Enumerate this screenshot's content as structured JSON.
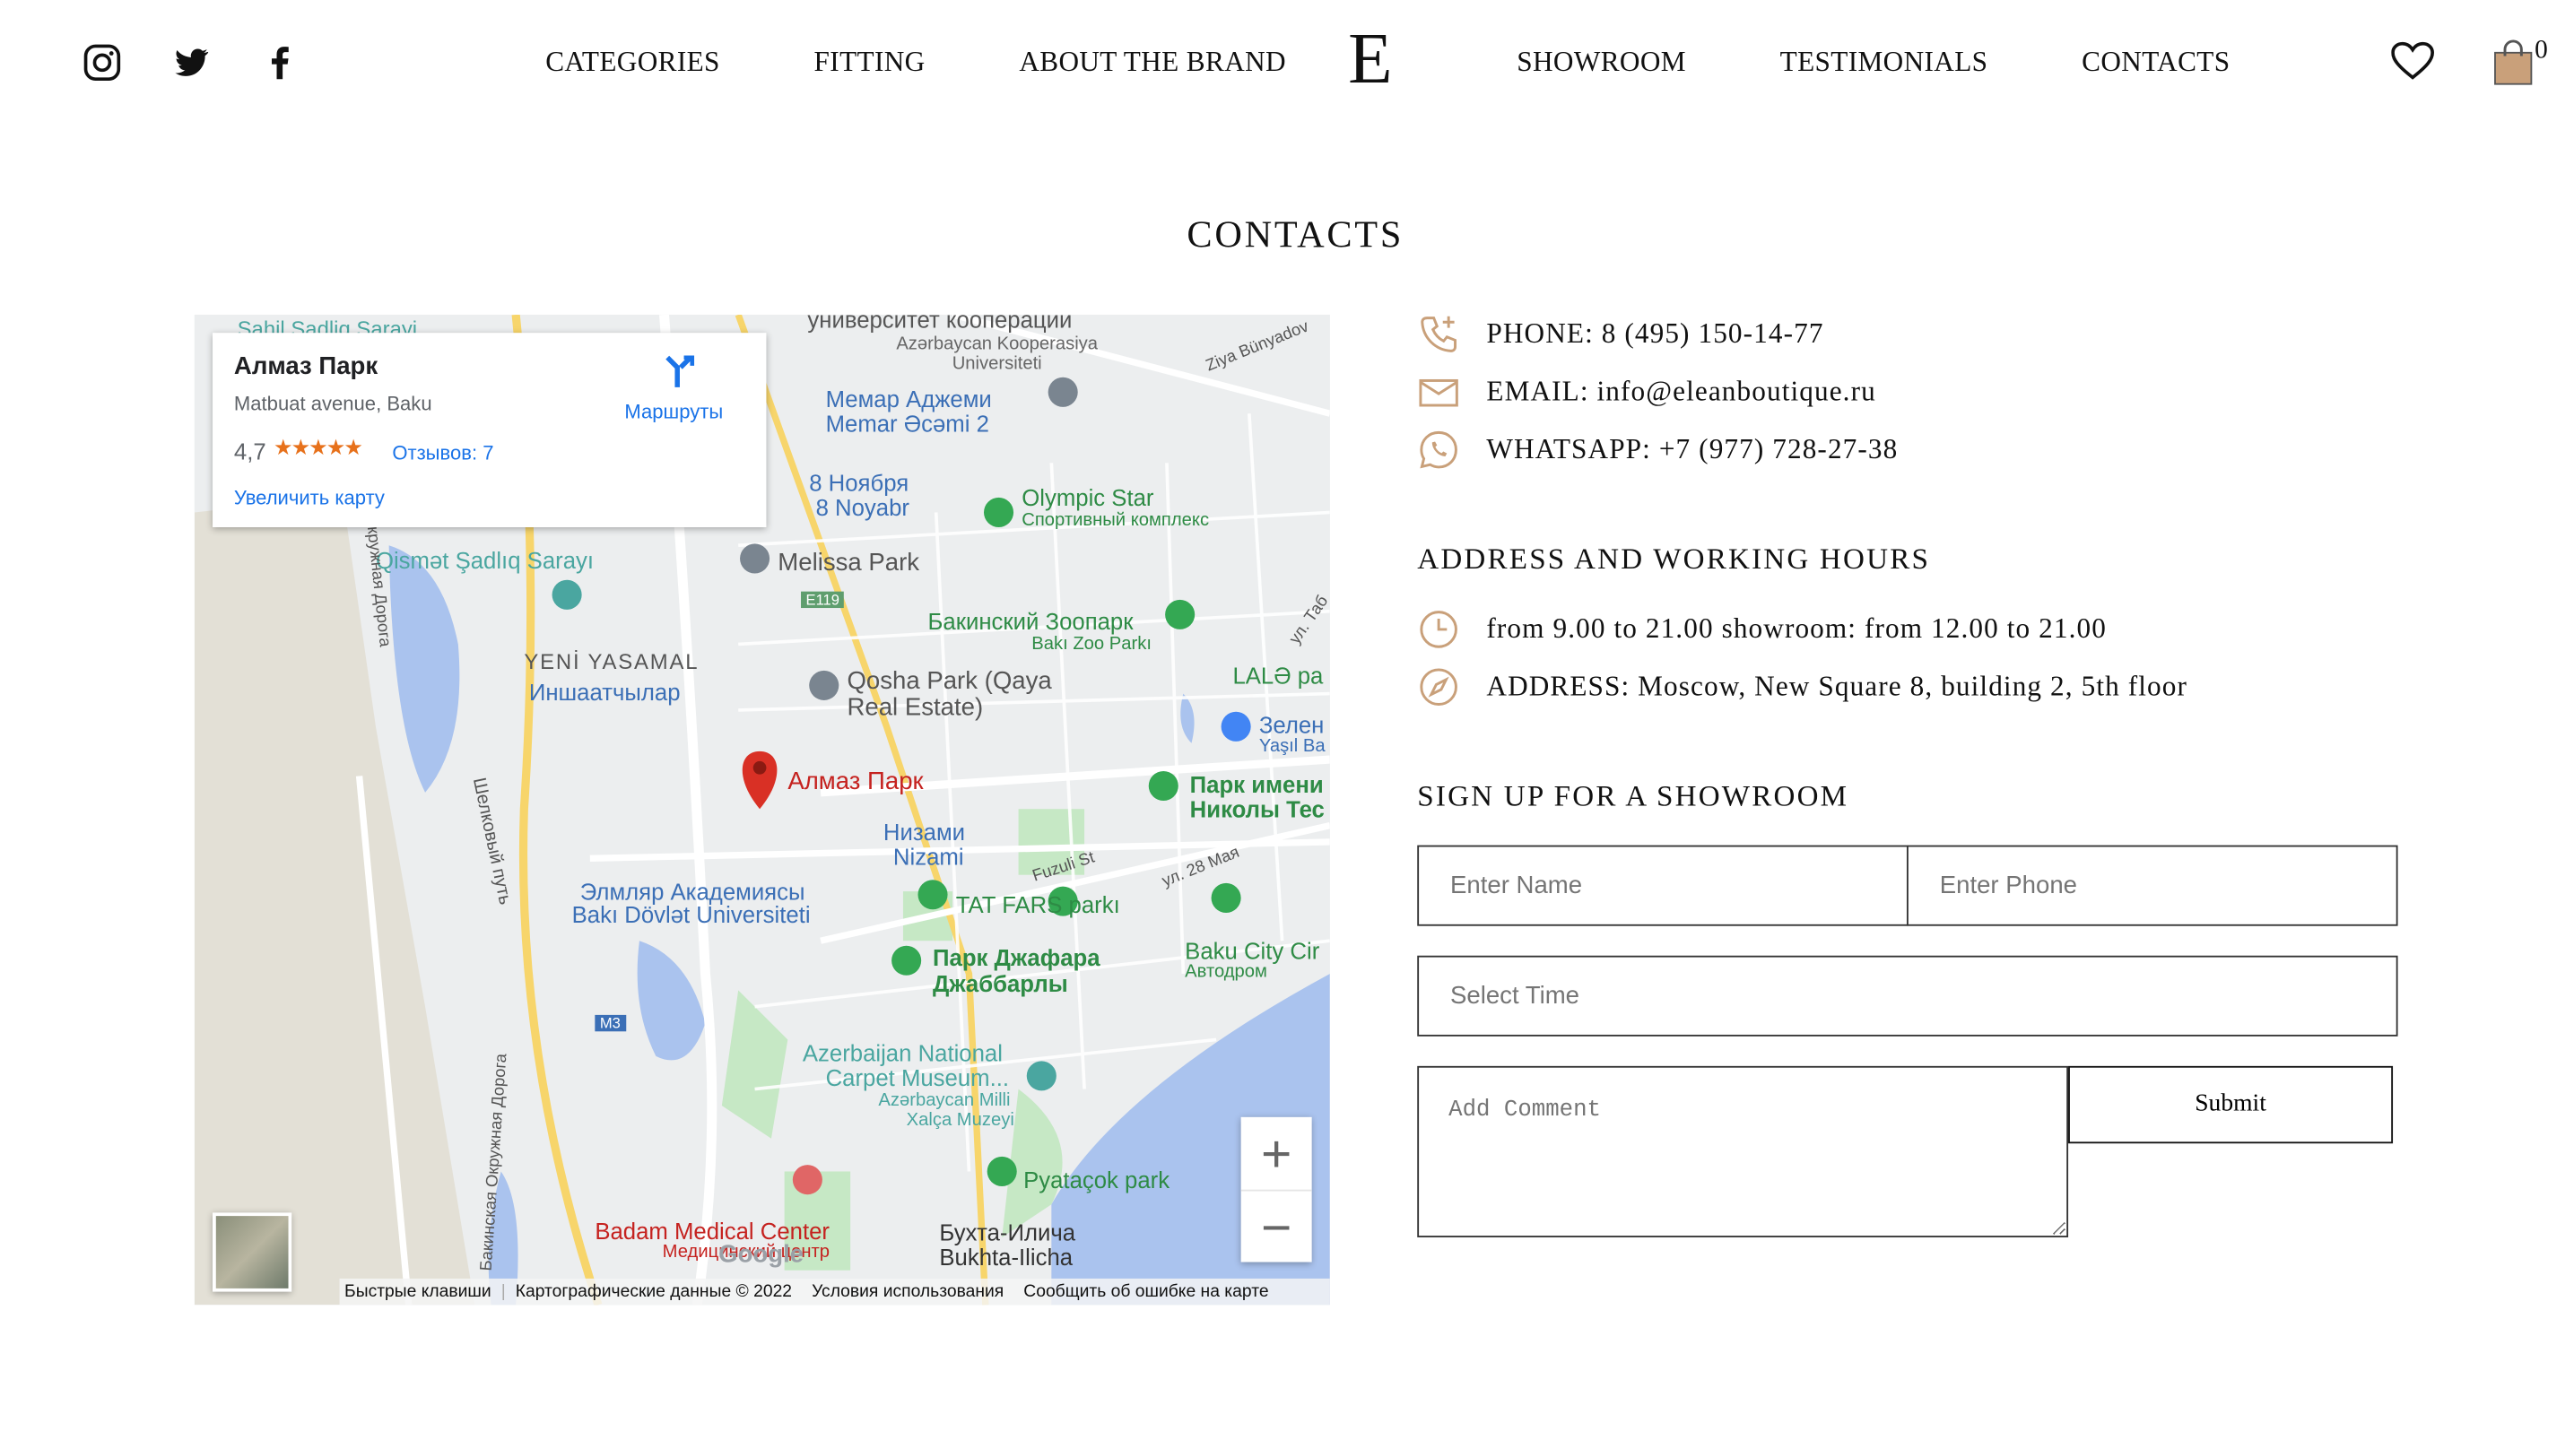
{
  "header": {
    "social": [
      "instagram-icon",
      "twitter-icon",
      "facebook-icon"
    ],
    "nav_left": [
      "CATEGORIES",
      "FITTING",
      "ABOUT THE BRAND"
    ],
    "logo": "E",
    "nav_right": [
      "SHOWROOM",
      "TESTIMONIALS",
      "CONTACTS"
    ],
    "cart_count": "0"
  },
  "page_title": "CONTACTS",
  "map": {
    "card": {
      "place": "Алмаз Парк",
      "address": "Matbuat avenue, Baku",
      "rating": "4,7",
      "reviews": "Отзывов: 7",
      "enlarge": "Увеличить карту",
      "directions": "Маршруты"
    },
    "labels": [
      "Sahil Sadliq Sarayi",
      "университет кооперации",
      "Azərbaycan Kooperasiya Universiteti",
      "Ziya Bünyadov",
      "Мемар Аджеми",
      "Memar Əcəmi 2",
      "8 Ноября",
      "8 Noyabr",
      "Olympic Star",
      "Спортивный комплекс",
      "Qismət Şadlıq Sarayı",
      "Melissa Park",
      "E119",
      "YENİ YASAMAL",
      "Иншаатчылар",
      "Бакинский Зоопарк",
      "Bakı Zoo Parkı",
      "Qosha Park (Qaya",
      "Real Estate)",
      "LALƏ pa",
      "Зелен",
      "Yaşıl Ba",
      "Алмаз Парк",
      "Парк имени",
      "Николы Тес",
      "Низами",
      "Nizami",
      "Fuzuli St",
      "ул. 28 Мая",
      "Элмляр Академиясы",
      "Bakı Dövlət Universiteti",
      "TAT FARS parkı",
      "Парк Джафара",
      "Джаббарлы",
      "Baku City Cir",
      "Автодром",
      "M3",
      "Azerbaijan National",
      "Carpet Museum...",
      "Azərbaycan Milli",
      "Xalça Muzeyi",
      "Pyataçok park",
      "Badam Medical Center",
      "Медицинский центр",
      "Бухта-Илича",
      "Bukhta-Ilicha",
      "Шелковый путь",
      "кружная Дорога",
      "Бакинская Окружная Дорога",
      "ул. Таб"
    ],
    "footer": [
      "Быстрые клавиши",
      "Картографические данные © 2022",
      "Условия использования",
      "Сообщить об ошибке на карте"
    ],
    "zoom_in": "+",
    "zoom_out": "−",
    "google": "Google"
  },
  "contacts": {
    "phone": "PHONE: 8 (495) 150-14-77",
    "email": "EMAIL: info@eleanboutique.ru",
    "whatsapp": "WHATSAPP: +7 (977) 728-27-38"
  },
  "address_section": {
    "heading": "ADDRESS AND WORKING HOURS",
    "hours": "from 9.00 to 21.00 showroom: from 12.00 to 21.00",
    "address": "ADDRESS: Moscow, New Square 8, building 2, 5th floor"
  },
  "signup": {
    "heading": "SIGN UP FOR A SHOWROOM",
    "name_placeholder": "Enter Name",
    "phone_placeholder": "Enter Phone",
    "time_placeholder": "Select Time",
    "comment_placeholder": "Add Comment",
    "submit": "Submit"
  },
  "colors": {
    "icon": "#c9a07a",
    "map_water": "#aac3ee",
    "map_park": "#c6e8c5",
    "pin": "#d93025",
    "link": "#1a73e8"
  }
}
